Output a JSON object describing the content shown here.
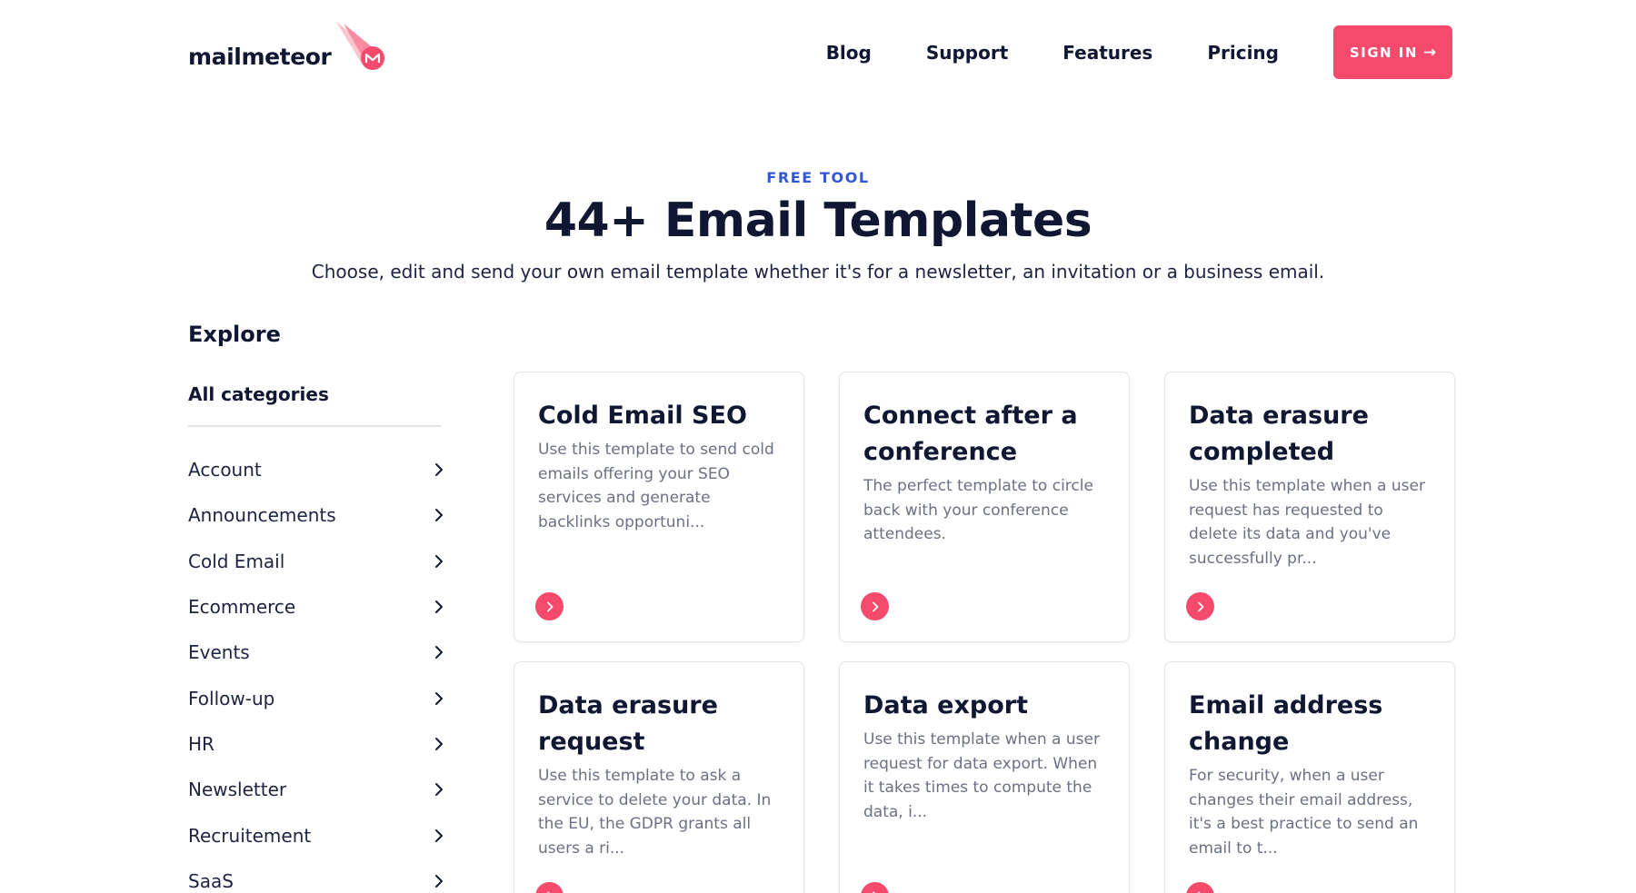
{
  "header": {
    "logo_text": "mailmeteor",
    "nav": [
      "Blog",
      "Support",
      "Features",
      "Pricing"
    ],
    "signin_label": "SIGN IN",
    "accent_color": "#f54a6c"
  },
  "hero": {
    "eyebrow": "FREE TOOL",
    "title": "44+ Email Templates",
    "subtitle": "Choose, edit and send your own email template whether it's for a newsletter, an invitation or a business email."
  },
  "sidebar": {
    "heading": "Explore",
    "all_label": "All categories",
    "categories": [
      "Account",
      "Announcements",
      "Cold Email",
      "Ecommerce",
      "Events",
      "Follow-up",
      "HR",
      "Newsletter",
      "Recruitement",
      "SaaS"
    ]
  },
  "cards": [
    {
      "title": "Cold Email SEO",
      "desc": "Use this template to send cold emails offering your SEO services and generate backlinks opportuni..."
    },
    {
      "title": "Connect after a conference",
      "desc": "The perfect template to circle back with your conference attendees."
    },
    {
      "title": "Data erasure completed",
      "desc": "Use this template when a user request has requested to delete its data and you've successfully pr..."
    },
    {
      "title": "Data erasure request",
      "desc": "Use this template to ask a service to delete your data. In the EU, the GDPR grants all users a ri..."
    },
    {
      "title": "Data export",
      "desc": "Use this template when a user request for data export. When it takes times to compute the data, i..."
    },
    {
      "title": "Email address change",
      "desc": "For security, when a user changes their email address, it's a best practice to send an email to t..."
    }
  ]
}
